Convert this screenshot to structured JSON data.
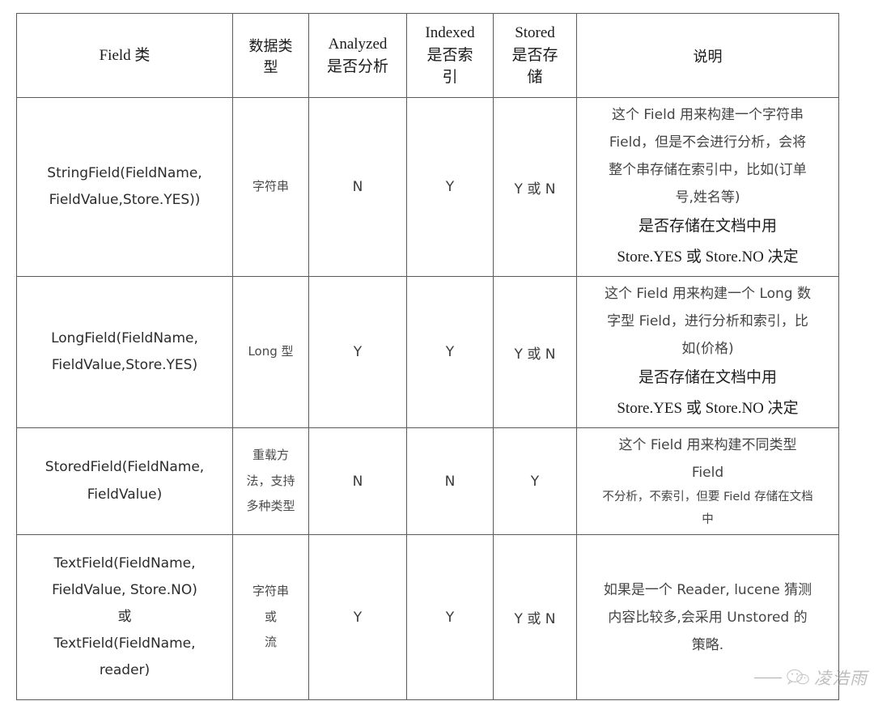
{
  "table": {
    "headers": [
      {
        "label": "Field 类",
        "name": "header-field-class"
      },
      {
        "label_line1": "数据类",
        "label_line2": "型",
        "name": "header-data-type"
      },
      {
        "label_line1": "Analyzed",
        "label_line2": "是否分析",
        "name": "header-analyzed"
      },
      {
        "label_line1": "Indexed",
        "label_line2": "是否索",
        "label_line3": "引",
        "name": "header-indexed"
      },
      {
        "label_line1": "Stored",
        "label_line2": "是否存",
        "label_line3": "储",
        "name": "header-stored"
      },
      {
        "label": "说明",
        "name": "header-description"
      }
    ],
    "rows": [
      {
        "field_class_lines": [
          "StringField(FieldName,",
          "FieldValue,Store.YES))"
        ],
        "data_type_lines": [
          "字符串"
        ],
        "analyzed": "N",
        "indexed": "Y",
        "stored": "Y 或 N",
        "desc_lines": [
          {
            "text": "这个 Field 用来构建一个字符串",
            "style": "normal"
          },
          {
            "text": "Field，但是不会进行分析，会将",
            "style": "normal"
          },
          {
            "text": "整个串存储在索引中，比如(订单",
            "style": "normal"
          },
          {
            "text": "号,姓名等)",
            "style": "normal"
          },
          {
            "text": "是否存储在文档中用",
            "style": "serif"
          },
          {
            "text": "Store.YES 或 Store.NO 决定",
            "style": "serif"
          }
        ]
      },
      {
        "field_class_lines": [
          "LongField(FieldName,",
          "FieldValue,Store.YES)"
        ],
        "data_type_lines": [
          "Long 型"
        ],
        "analyzed": "Y",
        "indexed": "Y",
        "stored": "Y 或 N",
        "desc_lines": [
          {
            "text": "这个 Field 用来构建一个 Long 数",
            "style": "normal"
          },
          {
            "text": "字型 Field，进行分析和索引，比",
            "style": "normal"
          },
          {
            "text": "如(价格)",
            "style": "normal"
          },
          {
            "text": "是否存储在文档中用",
            "style": "serif"
          },
          {
            "text": "Store.YES 或 Store.NO 决定",
            "style": "serif"
          }
        ]
      },
      {
        "field_class_lines": [
          "StoredField(FieldName,",
          "FieldValue)"
        ],
        "data_type_lines": [
          "重载方",
          "法，支持",
          "多种类型"
        ],
        "analyzed": "N",
        "indexed": "N",
        "stored": "Y",
        "desc_lines": [
          {
            "text": "这个 Field 用来构建不同类型",
            "style": "normal"
          },
          {
            "text": "Field",
            "style": "normal"
          },
          {
            "text": "不分析，不索引，但要 Field 存储在文档",
            "style": "small"
          },
          {
            "text": "中",
            "style": "small"
          }
        ]
      },
      {
        "field_class_lines": [
          "TextField(FieldName,",
          "FieldValue, Store.NO)",
          "或",
          "TextField(FieldName,",
          "reader)"
        ],
        "data_type_lines": [
          "字符串",
          "或",
          "流"
        ],
        "analyzed": "Y",
        "indexed": "Y",
        "stored": "Y 或 N",
        "desc_lines": [
          {
            "text": "如果是一个 Reader, lucene 猜测",
            "style": "normal"
          },
          {
            "text": "内容比较多,会采用 Unstored 的",
            "style": "normal"
          },
          {
            "text": "策略.",
            "style": "normal"
          }
        ]
      }
    ]
  },
  "watermark": {
    "name": "凌浩雨",
    "icon": "wechat-icon"
  }
}
